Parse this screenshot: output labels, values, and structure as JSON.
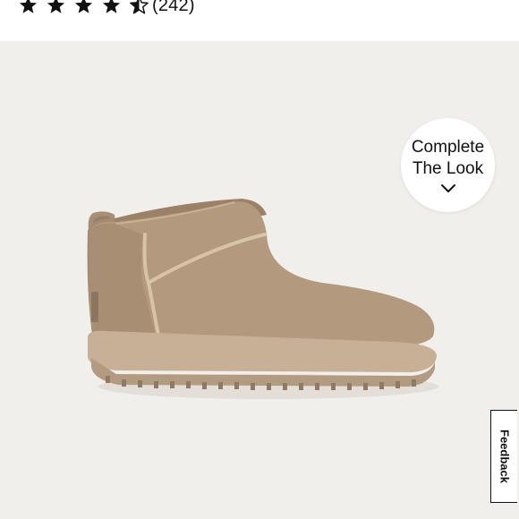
{
  "rating": {
    "stars": [
      "star-icon",
      "star-icon",
      "star-icon",
      "star-icon",
      "star-half-icon"
    ],
    "count_label": "(242)"
  },
  "product": {
    "image_icon": "ankle-boot-image",
    "complete_look_line1": "Complete",
    "complete_look_line2": "The Look",
    "complete_look_icon": "chevron-down-icon"
  },
  "feedback": {
    "label": "Feedback"
  },
  "colors": {
    "background": "#f1efeb",
    "boot": "#b39a7f",
    "sole": "#c7b095",
    "text": "#111111"
  }
}
